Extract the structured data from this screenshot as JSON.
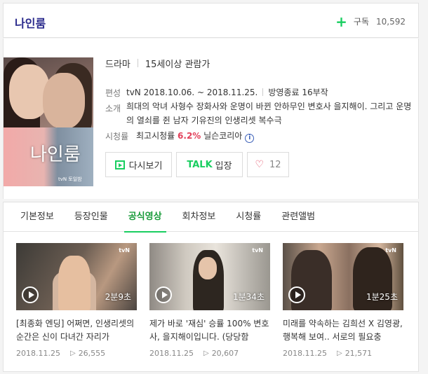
{
  "header": {
    "title": "나인룸",
    "subscribe_label": "구독",
    "subscribe_count": "10,592"
  },
  "info": {
    "genre": "드라마",
    "rating": "15세이상 관람가",
    "schedule_label": "편성",
    "channel": "tvN",
    "dates": "2018.10.06. ~ 2018.11.25.",
    "status": "방영종료 16부작",
    "intro_label": "소개",
    "intro_text": "희대의 악녀 사형수 장화사와 운명이 바뀐 안하무인 변호사 을지해이. 그리고 운명의 열쇠를 쥔 남자 기유진의 인생리셋 복수극",
    "ratings_label": "시청률",
    "ratings_prefix": "최고시청률",
    "ratings_value": "6.2%",
    "ratings_source": "닐슨코리아",
    "poster_logo": "나인룸",
    "poster_channel": "tvN 토일밤"
  },
  "buttons": {
    "replay": "다시보기",
    "talk_brand": "TALK",
    "talk_enter": "입장",
    "like_count": "12"
  },
  "tabs": [
    "기본정보",
    "등장인물",
    "공식영상",
    "회차정보",
    "시청률",
    "관련앨범"
  ],
  "active_tab": "공식영상",
  "clips": [
    {
      "title": "[최종화 엔딩] 어쩌면, 인생리셋의 순간은 신이 다녀간 자리가",
      "duration": "2분9초",
      "date": "2018.11.25",
      "views": "26,555"
    },
    {
      "title": "제가 바로 '재심' 승률 100% 변호사, 을지해이입니다. (당당함",
      "duration": "1분34초",
      "date": "2018.11.25",
      "views": "20,607"
    },
    {
      "title": "미래를 약속하는 김희선 X 김영광, 행복해 보여.. 서로의 필요충",
      "duration": "1분25초",
      "date": "2018.11.25",
      "views": "21,571"
    }
  ],
  "thumb_channel": "tvN",
  "colors": {
    "accent_green": "#19ce60",
    "title_navy": "#2a2a8c",
    "rating_red": "#e2405a"
  }
}
